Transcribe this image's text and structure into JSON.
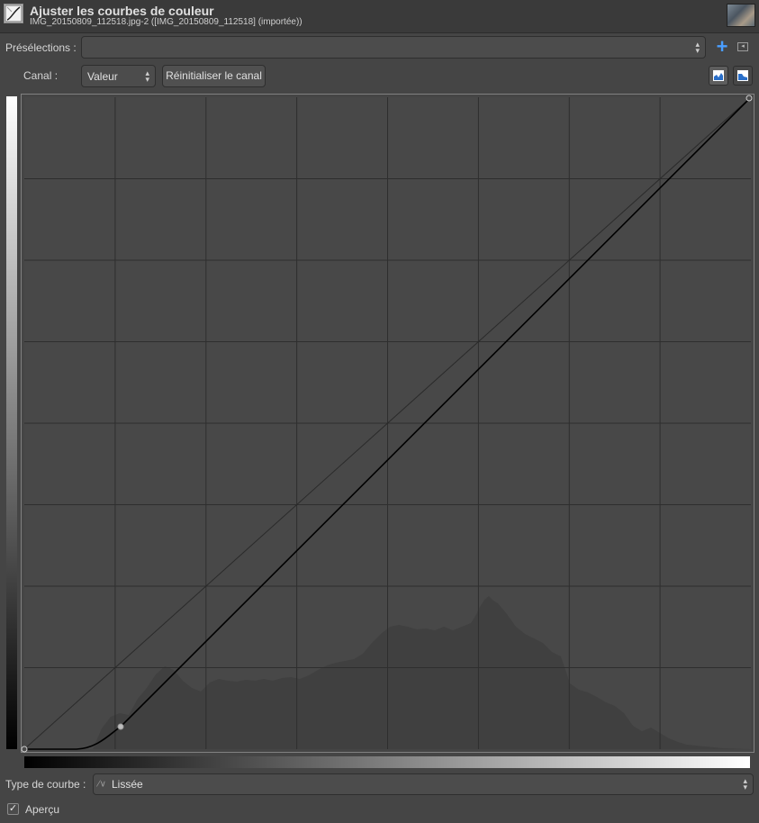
{
  "window": {
    "title": "Ajuster les courbes de couleur",
    "subtitle": "IMG_20150809_112518.jpg-2 ([IMG_20150809_112518] (importée))",
    "icon": "curves-tool-icon",
    "thumbnail": "image-thumbnail"
  },
  "presets": {
    "label": "Présélections :",
    "value": "",
    "add_icon": "plus-icon",
    "menu_icon": "menu-icon"
  },
  "channel": {
    "label": "Canal :",
    "value": "Valeur",
    "reset_label": "Réinitialiser le canal",
    "linear_hist_icon": "linear-histogram-icon",
    "log_hist_icon": "log-histogram-icon"
  },
  "curve": {
    "line_color": "#000000",
    "grid_color": "#2b2b2b",
    "histogram_color": "#3e3e3e",
    "control_points": [
      {
        "input": 0,
        "output": 0
      },
      {
        "input": 34,
        "output": 8
      },
      {
        "input": 255,
        "output": 255
      }
    ]
  },
  "curve_type": {
    "label": "Type de courbe :",
    "value": "Lissée",
    "icon": "smooth-curve-icon"
  },
  "preview": {
    "label": "Aperçu",
    "checked": true
  }
}
